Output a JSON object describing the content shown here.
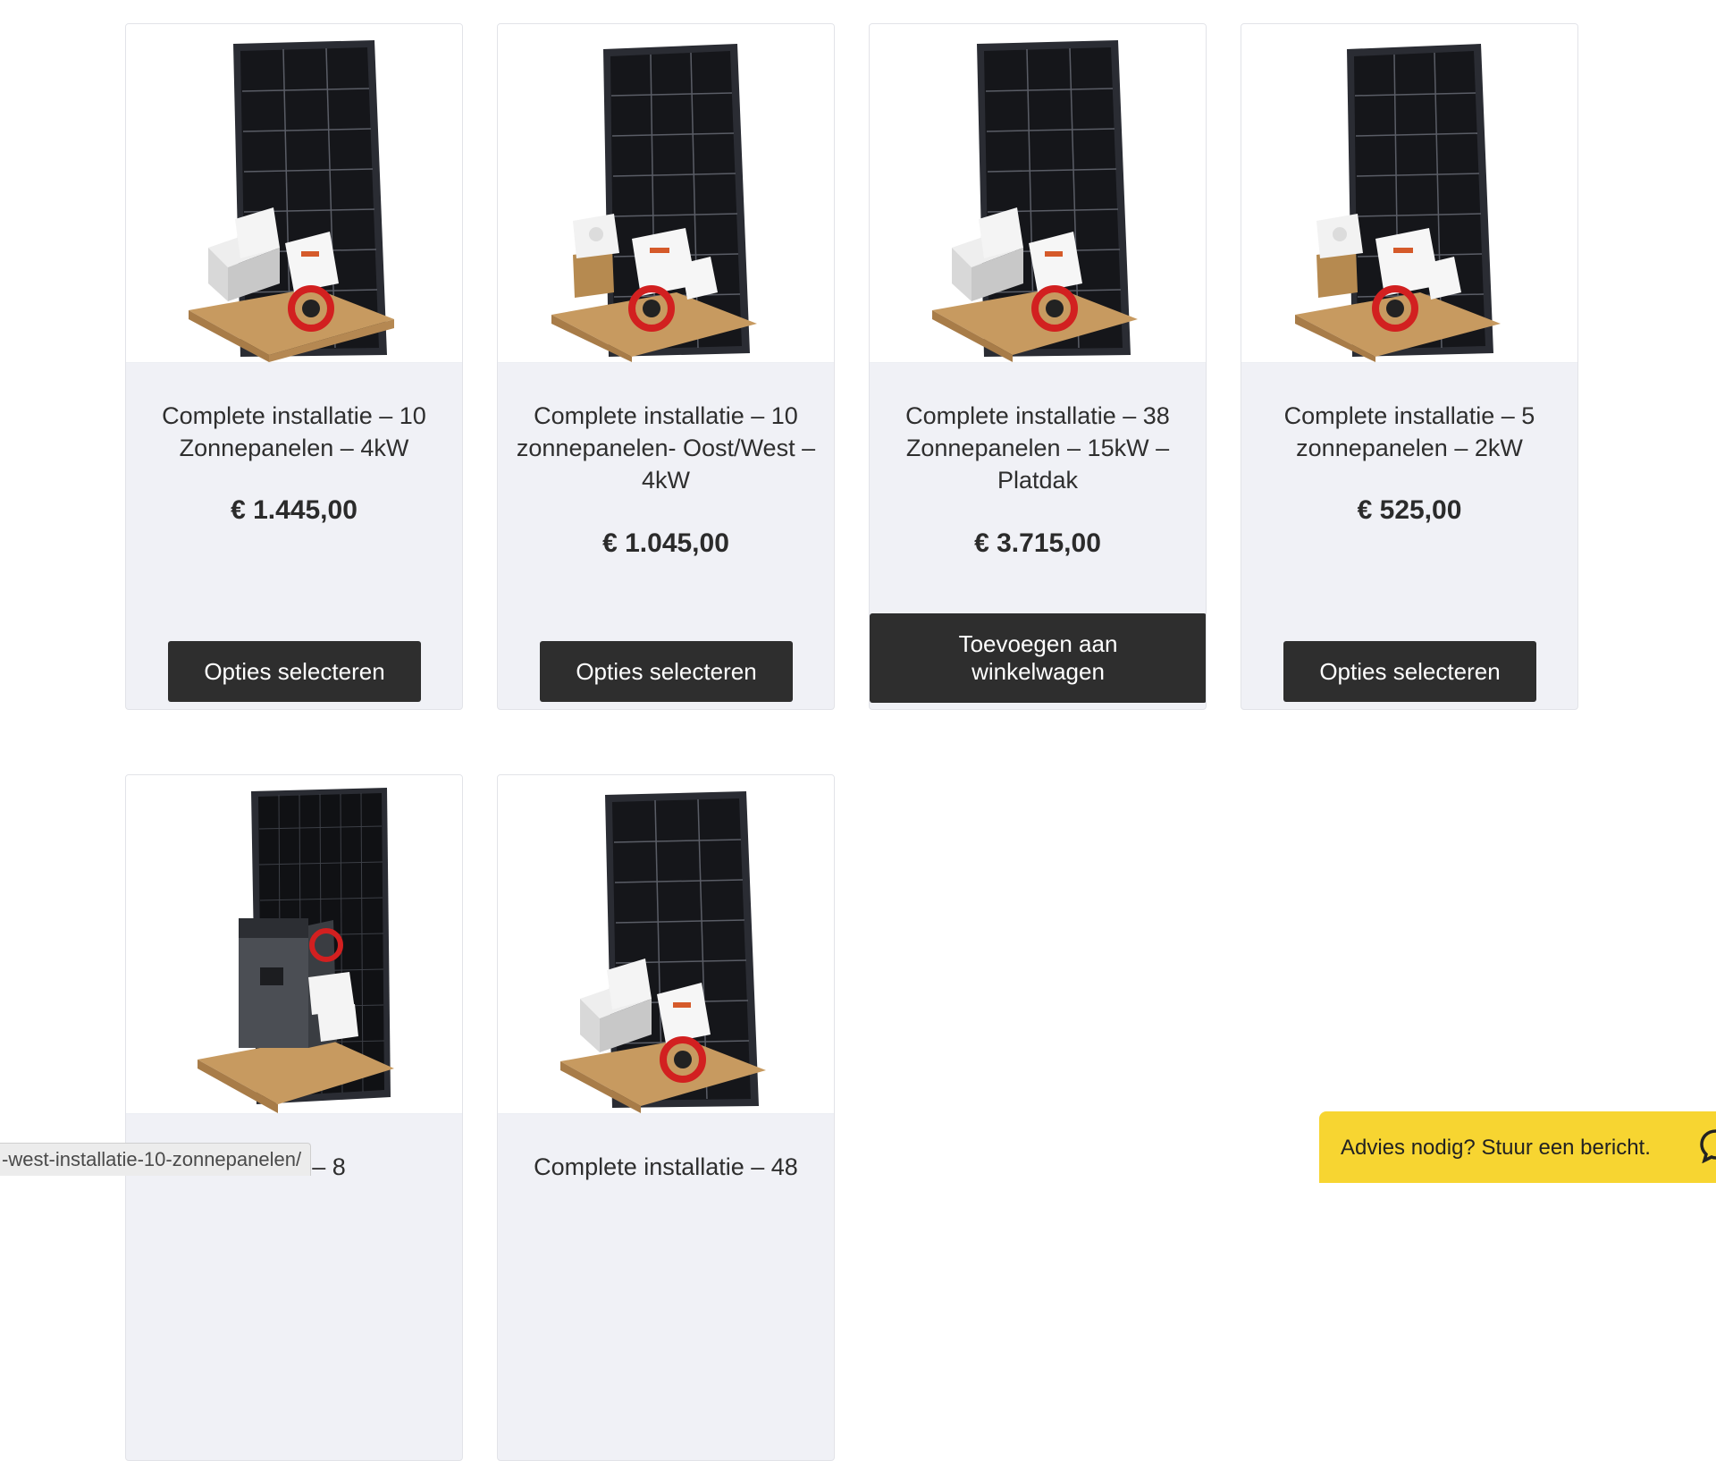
{
  "products": [
    {
      "title": "Complete installatie – 10 Zonnepanelen – 4kW",
      "price": "€ 1.445,00",
      "button": "Opties selecteren",
      "image_variant": "kit-inverter"
    },
    {
      "title": "Complete installatie – 10 zonnepanelen- Oost/West – 4kW",
      "price": "€ 1.045,00",
      "button": "Opties selecteren",
      "image_variant": "kit-inverter-box"
    },
    {
      "title": "Complete installatie – 38 Zonnepanelen – 15kW – Platdak",
      "price": "€ 3.715,00",
      "button": "Toevoegen aan winkelwagen",
      "image_variant": "kit-inverter"
    },
    {
      "title": "Complete installatie – 5 zonnepanelen – 2kW",
      "price": "€ 525,00",
      "button": "Opties selecteren",
      "image_variant": "kit-inverter-box"
    },
    {
      "title": "allatie – 8",
      "image_variant": "kit-battery"
    },
    {
      "title": "Complete installatie – 48",
      "image_variant": "kit-inverter"
    }
  ],
  "status_bar": {
    "url": "-west-installatie-10-zonnepanelen/"
  },
  "chat_widget": {
    "label": "Advies nodig? Stuur een bericht.",
    "icon": "chat-bubble-icon",
    "color": "#f7d531"
  },
  "colors": {
    "button_bg": "#2e2e2e",
    "card_bg": "#f0f1f6"
  }
}
